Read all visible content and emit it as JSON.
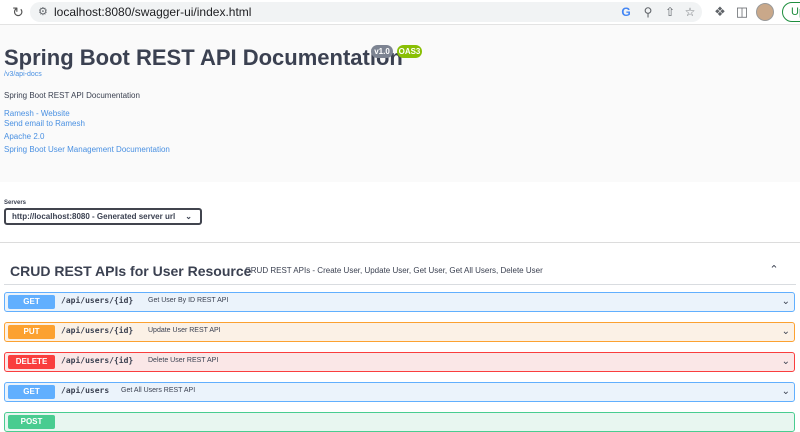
{
  "browser": {
    "url": "localhost:8080/swagger-ui/index.html",
    "update_label": "Up"
  },
  "info": {
    "title": "Spring Boot REST API Documentation",
    "version": "v1.0",
    "oas": "OAS3",
    "docs_link": "/v3/api-docs",
    "description": "Spring Boot REST API Documentation",
    "links": [
      "Ramesh - Website",
      "Send email to Ramesh",
      "Apache 2.0",
      "Spring Boot User Management Documentation"
    ]
  },
  "servers": {
    "label": "Servers",
    "selected": "http://localhost:8080 - Generated server url"
  },
  "tag": {
    "name": "CRUD REST APIs for User Resource",
    "description": "CRUD REST APIs - Create User, Update User, Get User, Get All Users, Delete User"
  },
  "operations": [
    {
      "method": "GET",
      "path": "/api/users/{id}",
      "summary": "Get User By ID REST API"
    },
    {
      "method": "PUT",
      "path": "/api/users/{id}",
      "summary": "Update User REST API"
    },
    {
      "method": "DELETE",
      "path": "/api/users/{id}",
      "summary": "Delete User REST API"
    },
    {
      "method": "GET",
      "path": "/api/users",
      "summary": "Get All Users REST API"
    },
    {
      "method": "POST",
      "path": "",
      "summary": ""
    }
  ],
  "colors": {
    "get": "#61affe",
    "put": "#fca130",
    "delete": "#f93e3e",
    "post": "#49cc90",
    "link": "#4990e2",
    "badge_version": "#7d8492",
    "badge_oas": "#89bf04"
  },
  "icons": {
    "reload": "reload-icon",
    "site_info": "tune-icon",
    "google": "google-icon",
    "zoom": "zoom-icon",
    "share": "share-icon",
    "bookmark": "star-icon",
    "extensions": "puzzle-icon",
    "side_panel": "side-panel-icon",
    "profile": "avatar",
    "collapse": "chevron-up-icon",
    "expand": "chevron-down-icon"
  }
}
